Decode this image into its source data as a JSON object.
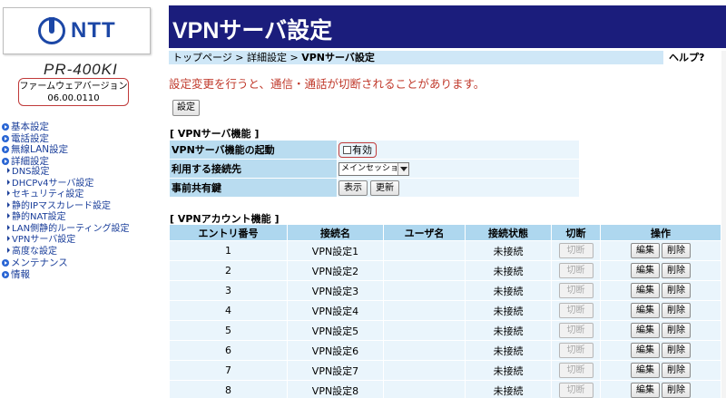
{
  "brand": {
    "logo_text": "NTT",
    "model": "PR-400KI",
    "fw_label": "ファームウェアバージョン",
    "fw_version": "06.00.0110"
  },
  "nav": [
    {
      "label": "基本設定",
      "level": 0
    },
    {
      "label": "電話設定",
      "level": 0
    },
    {
      "label": "無線LAN設定",
      "level": 0
    },
    {
      "label": "詳細設定",
      "level": 0
    },
    {
      "label": "DNS設定",
      "level": 1
    },
    {
      "label": "DHCPv4サーバ設定",
      "level": 1
    },
    {
      "label": "セキュリティ設定",
      "level": 1
    },
    {
      "label": "静的IPマスカレード設定",
      "level": 1
    },
    {
      "label": "静的NAT設定",
      "level": 1
    },
    {
      "label": "LAN側静的ルーティング設定",
      "level": 1
    },
    {
      "label": "VPNサーバ設定",
      "level": 1
    },
    {
      "label": "高度な設定",
      "level": 1
    },
    {
      "label": "メンテナンス",
      "level": 0
    },
    {
      "label": "情報",
      "level": 0
    }
  ],
  "header": {
    "title": "VPNサーバ設定",
    "breadcrumb_prefix": "トップページ > 詳細設定 > ",
    "breadcrumb_current": "VPNサーバ設定",
    "help": "ヘルプ?"
  },
  "warning": "設定変更を行うと、通信・通話が切断されることがあります。",
  "settings_button": "設定",
  "vpn_function": {
    "title": "[ VPNサーバ機能 ]",
    "enable_label": "VPNサーバ機能の起動",
    "enable_checkbox": "有効",
    "connection_label": "利用する接続先",
    "connection_value": "メインセッション",
    "psk_label": "事前共有鍵",
    "show_button": "表示",
    "update_button": "更新"
  },
  "vpn_accounts": {
    "title": "[ VPNアカウント機能 ]",
    "columns": [
      "エントリ番号",
      "接続名",
      "ユーザ名",
      "接続状態",
      "切断",
      "操作"
    ],
    "disconnect_label": "切断",
    "edit_label": "編集",
    "delete_label": "削除",
    "rows": [
      {
        "no": "1",
        "name": "VPN設定1",
        "user": "",
        "status": "未接続"
      },
      {
        "no": "2",
        "name": "VPN設定2",
        "user": "",
        "status": "未接続"
      },
      {
        "no": "3",
        "name": "VPN設定3",
        "user": "",
        "status": "未接続"
      },
      {
        "no": "4",
        "name": "VPN設定4",
        "user": "",
        "status": "未接続"
      },
      {
        "no": "5",
        "name": "VPN設定5",
        "user": "",
        "status": "未接続"
      },
      {
        "no": "6",
        "name": "VPN設定6",
        "user": "",
        "status": "未接続"
      },
      {
        "no": "7",
        "name": "VPN設定7",
        "user": "",
        "status": "未接続"
      },
      {
        "no": "8",
        "name": "VPN設定8",
        "user": "",
        "status": "未接続"
      }
    ]
  }
}
